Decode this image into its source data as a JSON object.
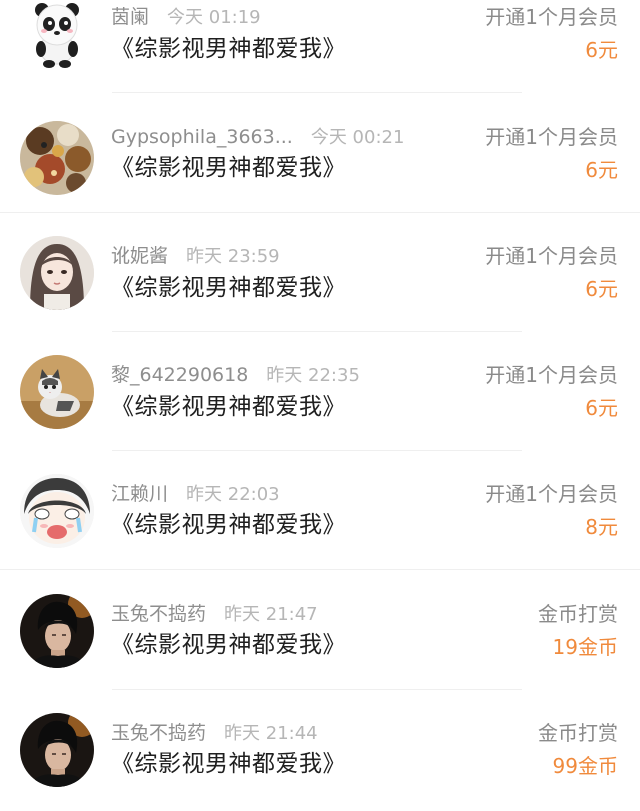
{
  "colors": {
    "amount": "#f08a3c",
    "username": "#8e8e8e",
    "timestamp": "#b6b6b6",
    "title": "#1f1f1f",
    "action": "#8a8a8a"
  },
  "records": [
    {
      "avatar": "panda-avatar",
      "username": "茵阑",
      "time": "今天 01:19",
      "title": "《综影视男神都爱我》",
      "action": "开通1个月会员",
      "amount": "6元"
    },
    {
      "avatar": "herbs-avatar",
      "username": "Gypsophila_3663...",
      "time": "今天 00:21",
      "title": "《综影视男神都爱我》",
      "action": "开通1个月会员",
      "amount": "6元"
    },
    {
      "avatar": "girl-avatar",
      "username": "讹妮酱",
      "time": "昨天 23:59",
      "title": "《综影视男神都爱我》",
      "action": "开通1个月会员",
      "amount": "6元"
    },
    {
      "avatar": "cat-avatar",
      "username": "黎_642290618",
      "time": "昨天 22:35",
      "title": "《综影视男神都爱我》",
      "action": "开通1个月会员",
      "amount": "6元"
    },
    {
      "avatar": "crying-face-avatar",
      "username": "江赖川",
      "time": "昨天 22:03",
      "title": "《综影视男神都爱我》",
      "action": "开通1个月会员",
      "amount": "8元"
    },
    {
      "avatar": "man-portrait-avatar",
      "username": "玉兔不捣药",
      "time": "昨天 21:47",
      "title": "《综影视男神都爱我》",
      "action": "金币打赏",
      "amount": "19金币"
    },
    {
      "avatar": "man-portrait-avatar",
      "username": "玉兔不捣药",
      "time": "昨天 21:44",
      "title": "《综影视男神都爱我》",
      "action": "金币打赏",
      "amount": "99金币"
    }
  ]
}
